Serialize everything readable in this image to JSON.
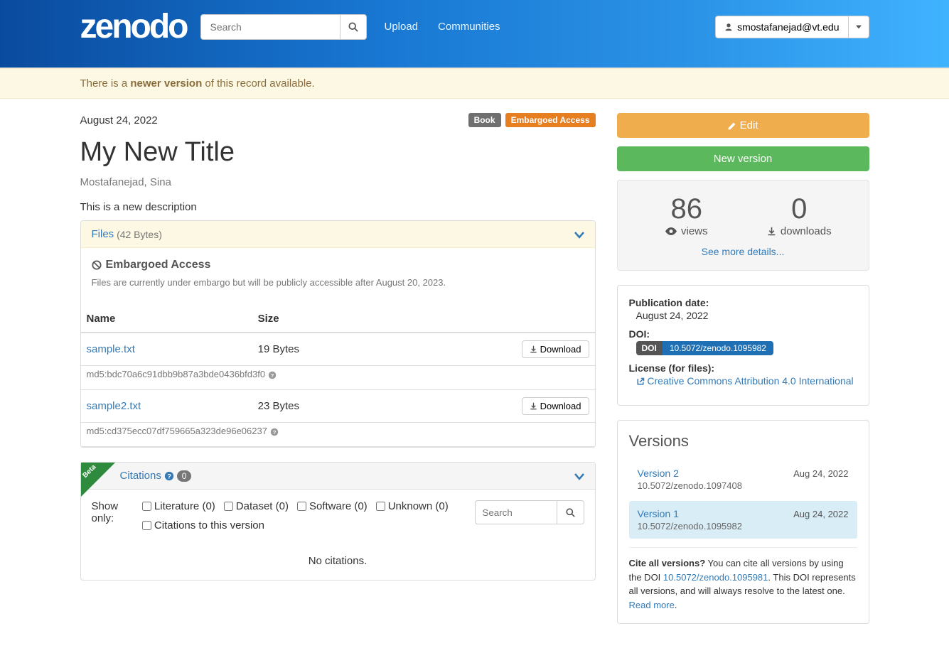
{
  "nav": {
    "search_placeholder": "Search",
    "upload": "Upload",
    "communities": "Communities",
    "user": "smostafanejad@vt.edu"
  },
  "alert": {
    "prefix": "There is a ",
    "bold": "newer version",
    "suffix": " of this record available."
  },
  "record": {
    "date": "August 24, 2022",
    "type_badge": "Book",
    "access_badge": "Embargoed Access",
    "title": "My New Title",
    "author": "Mostafanejad, Sina",
    "description": "This is a new description"
  },
  "files": {
    "heading": "Files",
    "size_total": "(42 Bytes)",
    "embargo_title": "Embargoed Access",
    "embargo_note": "Files are currently under embargo but will be publicly accessible after August 20, 2023.",
    "col_name": "Name",
    "col_size": "Size",
    "download_label": "Download",
    "items": [
      {
        "name": "sample.txt",
        "size": "19 Bytes",
        "md5": "md5:bdc70a6c91dbb9b87a3bde0436bfd3f0"
      },
      {
        "name": "sample2.txt",
        "size": "23 Bytes",
        "md5": "md5:cd375ecc07df759665a323de96e06237"
      }
    ]
  },
  "citations": {
    "heading": "Citations",
    "count": "0",
    "beta": "Beta",
    "show_only": "Show only:",
    "filters": [
      "Literature (0)",
      "Dataset (0)",
      "Software (0)",
      "Unknown (0)"
    ],
    "this_version": "Citations to this version",
    "search_placeholder": "Search",
    "none": "No citations."
  },
  "sidebar": {
    "edit": "Edit",
    "new_version": "New version",
    "stats": {
      "views_n": "86",
      "views_l": "views",
      "downloads_n": "0",
      "downloads_l": "downloads",
      "more": "See more details..."
    },
    "meta": {
      "pub_date_l": "Publication date:",
      "pub_date_v": "August 24, 2022",
      "doi_l": "DOI:",
      "doi_badge_l": "DOI",
      "doi_badge_v": "10.5072/zenodo.1095982",
      "license_l": "License (for files):",
      "license_v": "Creative Commons Attribution 4.0 International"
    },
    "versions": {
      "heading": "Versions",
      "items": [
        {
          "name": "Version 2",
          "date": "Aug 24, 2022",
          "doi": "10.5072/zenodo.1097408",
          "active": false
        },
        {
          "name": "Version 1",
          "date": "Aug 24, 2022",
          "doi": "10.5072/zenodo.1095982",
          "active": true
        }
      ],
      "cite_bold": "Cite all versions?",
      "cite_text_1": " You can cite all versions by using the DOI ",
      "cite_doi": "10.5072/zenodo.1095981",
      "cite_text_2": ". This DOI represents all versions, and will always resolve to the latest one. ",
      "read_more": "Read more"
    }
  }
}
